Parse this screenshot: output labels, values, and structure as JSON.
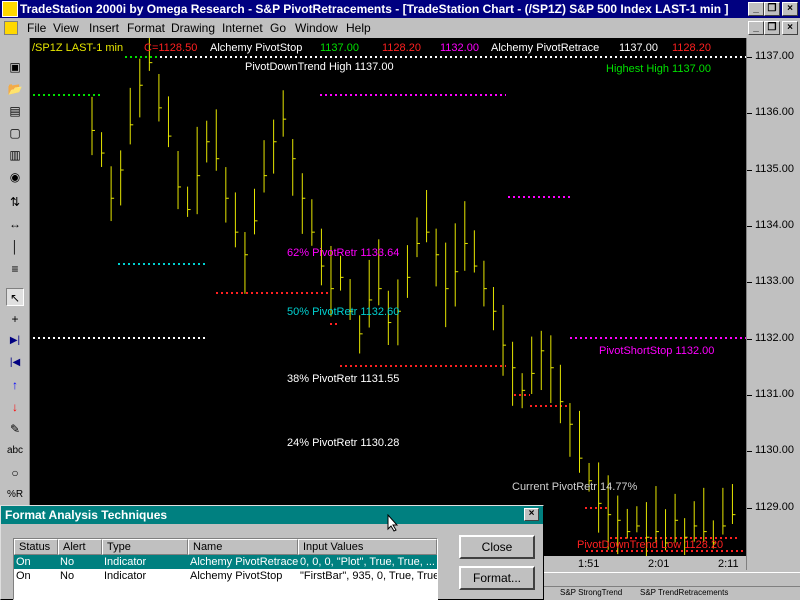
{
  "window": {
    "title": "TradeStation 2000i by Omega Research - S&P PivotRetracements - [TradeStation Chart - (/SP1Z) S&P 500 Index LAST-1 min ]",
    "btn_minimize": "_",
    "btn_restore": "❐",
    "btn_close": "×",
    "mdi_minimize": "_",
    "mdi_restore": "❐",
    "mdi_close": "×"
  },
  "menu": [
    "File",
    "View",
    "Insert",
    "Format",
    "Drawing",
    "Internet",
    "Go",
    "Window",
    "Help"
  ],
  "toolbar_glyphs": [
    "▣",
    "📂",
    "▤",
    "▦",
    "▢",
    "▥",
    "◉",
    "⇅",
    "↔",
    "│",
    "≡",
    "↖",
    "+",
    "▶|",
    "|◀",
    "↑",
    "↓",
    "✎",
    "abc",
    "○",
    "%R"
  ],
  "chart": {
    "header": {
      "symbol": "/SP1Z LAST-1 min",
      "close": "C=1128.50",
      "ind1_name": "Alchemy PivotStop",
      "ind1_v1": "1137.00",
      "ind1_v2": "1128.20",
      "ind2_v0": "1132.00",
      "ind2_name": "Alchemy PivotRetrace",
      "ind2_v1": "1137.00",
      "ind2_v2": "1128.20"
    },
    "labels": {
      "downtrend_high": "PivotDownTrend High 1137.00",
      "highest_high": "Highest High 1137.00",
      "retr62": "62% PivotRetr 1133.64",
      "retr50": "50% PivotRetr 1132.60",
      "retr38": "38% PivotRetr 1131.55",
      "retr24": "24% PivotRetr 1130.28",
      "short_stop": "PivotShortStop 1132.00",
      "current_retr": "Current PivotRetr 14.77%",
      "downtrend_low": "PivotDownTrend Low 1128.20"
    },
    "colors": {
      "bars": "#e6e600",
      "green": "#00e000",
      "magenta": "#ff00ff",
      "cyan": "#00d0d0",
      "red": "#ff2020",
      "white": "#ffffff"
    }
  },
  "yaxis": [
    "1137.00",
    "1136.00",
    "1135.00",
    "1134.00",
    "1133.00",
    "1132.00",
    "1131.00",
    "1130.00",
    "1129.00"
  ],
  "xaxis": [
    "1:51",
    "2:01",
    "2:11"
  ],
  "tabs": [
    "S&P StrongTrend",
    "S&P TrendRetracements"
  ],
  "dialog": {
    "title": "Format Analysis Techniques",
    "close_x": "×",
    "columns": [
      "Status",
      "Alert",
      "Type",
      "Name",
      "Input Values"
    ],
    "rows": [
      {
        "status": "On",
        "alert": "No",
        "type": "Indicator",
        "name": "Alchemy PivotRetrace",
        "inputs": "0, 0, 0, \"Plot\", True, True, ..."
      },
      {
        "status": "On",
        "alert": "No",
        "type": "Indicator",
        "name": "Alchemy PivotStop",
        "inputs": "\"FirstBar\", 935, 0, True, True, ..."
      }
    ],
    "close_button": "Close",
    "format_button": "Format..."
  }
}
